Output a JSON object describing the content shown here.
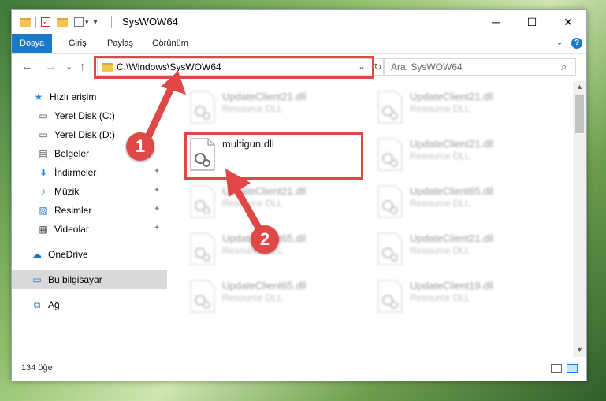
{
  "window": {
    "title": "SysWOW64",
    "controls": {
      "minimize": "─",
      "maximize": "☐",
      "close": "✕"
    }
  },
  "ribbon": {
    "tabs": [
      "Dosya",
      "Giriş",
      "Paylaş",
      "Görünüm"
    ],
    "expand": "⌄",
    "help": "?"
  },
  "nav": {
    "back": "←",
    "forward": "→",
    "recent": "⌄",
    "up": "↑",
    "address": "C:\\Windows\\SysWOW64",
    "address_dropdown": "⌄",
    "refresh": "↻",
    "search_placeholder": "Ara: SysWOW64",
    "search_icon": "⌕"
  },
  "sidebar": {
    "items": [
      {
        "label": "Hızlı erişim",
        "icon": "star-icon",
        "glyph": "★",
        "color": "#1e88e5"
      },
      {
        "label": "Yerel Disk (C:)",
        "icon": "drive-icon",
        "glyph": "▭",
        "color": "#555"
      },
      {
        "label": "Yerel Disk (D:)",
        "icon": "drive-icon",
        "glyph": "▭",
        "color": "#555"
      },
      {
        "label": "Belgeler",
        "icon": "documents-icon",
        "glyph": "▤",
        "color": "#555"
      },
      {
        "label": "İndirmeler",
        "icon": "download-icon",
        "glyph": "⬇",
        "color": "#1e88e5"
      },
      {
        "label": "Müzik",
        "icon": "music-icon",
        "glyph": "♪",
        "color": "#1e88e5"
      },
      {
        "label": "Resimler",
        "icon": "pictures-icon",
        "glyph": "▨",
        "color": "#3a7bd5"
      },
      {
        "label": "Videolar",
        "icon": "videos-icon",
        "glyph": "▦",
        "color": "#444"
      },
      {
        "label": "OneDrive",
        "icon": "cloud-icon",
        "glyph": "☁",
        "color": "#1e6fd9"
      },
      {
        "label": "Bu bilgisayar",
        "icon": "computer-icon",
        "glyph": "▭",
        "color": "#2a7ac8"
      },
      {
        "label": "Ağ",
        "icon": "network-icon",
        "glyph": "⧉",
        "color": "#2a7ac8"
      }
    ]
  },
  "files": [
    {
      "name": "UpdateClient21.dll",
      "desc": "Resource DLL",
      "blurred": true
    },
    {
      "name": "UpdateClient21.dll",
      "desc": "Resource DLL",
      "blurred": true
    },
    {
      "name": "multigun.dll",
      "desc": "",
      "blurred": false
    },
    {
      "name": "UpdateClient21.dll",
      "desc": "Resource DLL",
      "blurred": true
    },
    {
      "name": "UpdateClient21.dll",
      "desc": "Resource DLL",
      "blurred": true
    },
    {
      "name": "UpdateClient65.dll",
      "desc": "Resource DLL",
      "blurred": true
    },
    {
      "name": "UpdateClient65.dll",
      "desc": "Resource DLL",
      "blurred": true
    },
    {
      "name": "UpdateClient21.dll",
      "desc": "Resource DLL",
      "blurred": true
    },
    {
      "name": "UpdateClient65.dll",
      "desc": "Resource DLL",
      "blurred": true
    },
    {
      "name": "UpdateClient19.dll",
      "desc": "Resource DLL",
      "blurred": true
    }
  ],
  "status": {
    "count": "134 öğe"
  },
  "annotations": {
    "badge1": "1",
    "badge2": "2",
    "color": "#e04848"
  }
}
